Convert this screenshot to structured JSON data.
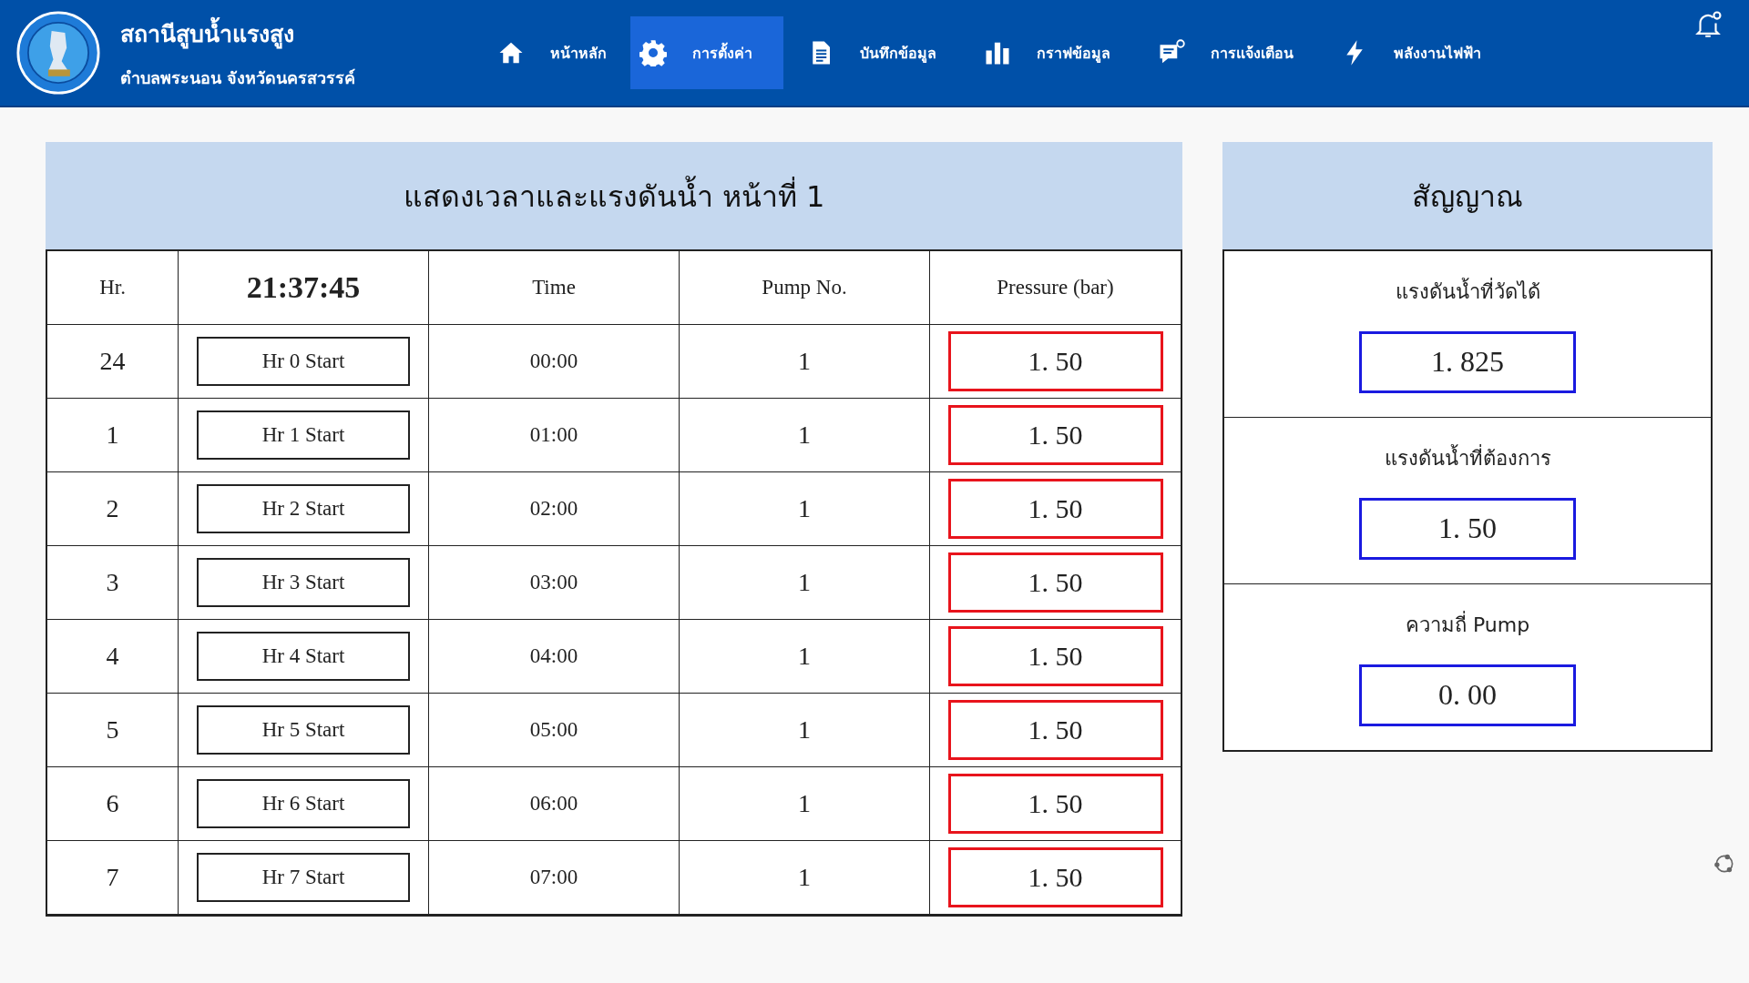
{
  "header": {
    "title": "สถานีสูบน้ำแรงสูง",
    "subtitle": "ตำบลพระนอน จังหวัดนครสวรรค์"
  },
  "nav": [
    {
      "kind": "home",
      "label": "หน้าหลัก",
      "selected": false
    },
    {
      "kind": "settings",
      "label": "การตั้งค่า",
      "selected": true
    },
    {
      "kind": "document",
      "label": "บันทึกข้อมูล",
      "selected": false
    },
    {
      "kind": "chart",
      "label": "กราฟข้อมูล",
      "selected": false
    },
    {
      "kind": "message",
      "label": "การแจ้งเตือน",
      "selected": false
    },
    {
      "kind": "bolt",
      "label": "พลังงานไฟฟ้า",
      "selected": false
    }
  ],
  "schedule": {
    "title": "แสดงเวลาและแรงดันน้ำ หน้าที่ 1",
    "clock": "21:37:45",
    "columns": [
      "Hr.",
      "Time",
      "Pump No.",
      "Pressure (bar)"
    ],
    "rows": [
      {
        "hr": "24",
        "button": "Hr 0 Start",
        "time": "00:00",
        "pump": "1",
        "pressure": "1. 50"
      },
      {
        "hr": "1",
        "button": "Hr 1 Start",
        "time": "01:00",
        "pump": "1",
        "pressure": "1. 50"
      },
      {
        "hr": "2",
        "button": "Hr 2 Start",
        "time": "02:00",
        "pump": "1",
        "pressure": "1. 50"
      },
      {
        "hr": "3",
        "button": "Hr 3 Start",
        "time": "03:00",
        "pump": "1",
        "pressure": "1. 50"
      },
      {
        "hr": "4",
        "button": "Hr 4 Start",
        "time": "04:00",
        "pump": "1",
        "pressure": "1. 50"
      },
      {
        "hr": "5",
        "button": "Hr 5 Start",
        "time": "05:00",
        "pump": "1",
        "pressure": "1. 50"
      },
      {
        "hr": "6",
        "button": "Hr 6 Start",
        "time": "06:00",
        "pump": "1",
        "pressure": "1. 50"
      },
      {
        "hr": "7",
        "button": "Hr 7 Start",
        "time": "07:00",
        "pump": "1",
        "pressure": "1. 50"
      }
    ]
  },
  "signal": {
    "title": "สัญญาณ",
    "items": [
      {
        "label": "แรงดันน้ำที่วัดได้",
        "value": "1. 825"
      },
      {
        "label": "แรงดันน้ำที่ต้องการ",
        "value": "1. 50"
      },
      {
        "label": "ความถี่ Pump",
        "value": "0. 00"
      }
    ]
  }
}
